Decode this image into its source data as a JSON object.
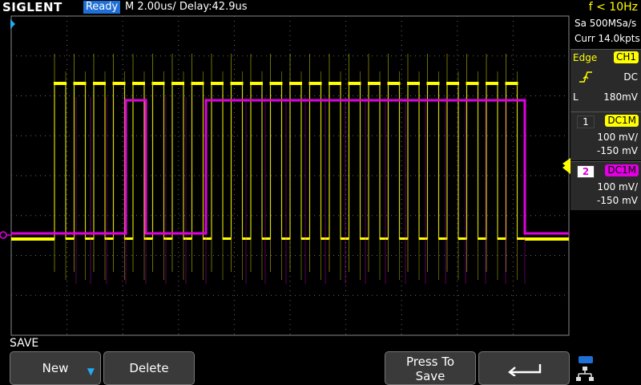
{
  "header": {
    "brand": "SIGLENT",
    "status": "Ready",
    "timebase": "M 2.00us/  Delay:42.9us",
    "frequency": "f < 10Hz"
  },
  "acquisition": {
    "sample_rate": "Sa 500MSa/s",
    "memory": "Curr 14.0kpts"
  },
  "trigger": {
    "type": "Edge",
    "source": "CH1",
    "slope_icon": "rising-edge-icon",
    "coupling": "DC",
    "mode": "L",
    "level": "180mV"
  },
  "channels": [
    {
      "number": "1",
      "coupling": "DC1M",
      "scale": "100 mV/",
      "offset": "-150 mV",
      "color": "#ffff00"
    },
    {
      "number": "2",
      "coupling": "DC1M",
      "scale": "100 mV/",
      "offset": "-150 mV",
      "color": "#e100e1"
    }
  ],
  "menu": {
    "title": "SAVE",
    "new_label": "New",
    "delete_label": "Delete",
    "press_to_save_line1": "Press To",
    "press_to_save_line2": "Save",
    "back_icon": "return-arrow-icon",
    "network_icon": "network-icon"
  },
  "colors": {
    "ch1": "#ffff00",
    "ch2": "#e100e1",
    "status_bg": "#1f6fd6",
    "grid": "#6a6a6a"
  }
}
